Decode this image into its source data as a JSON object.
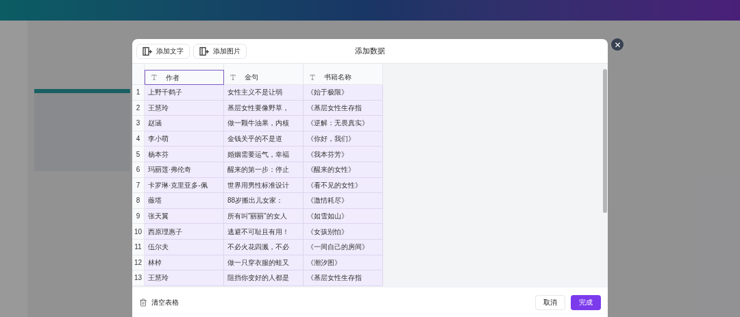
{
  "dialog": {
    "title": "添加数据",
    "toolbar": [
      {
        "label": "添加文字"
      },
      {
        "label": "添加图片"
      }
    ]
  },
  "table": {
    "columns": [
      {
        "label": "作者",
        "selected": true
      },
      {
        "label": "金句",
        "selected": false
      },
      {
        "label": "书籍名称",
        "selected": false
      }
    ],
    "rows": [
      {
        "number": "1",
        "cells": [
          "上野千鹤子",
          "女性主义不是让弱",
          "《始于极限》"
        ]
      },
      {
        "number": "2",
        "cells": [
          "王慧玲",
          "基层女性要像野草，",
          "《基层女性生存指"
        ]
      },
      {
        "number": "3",
        "cells": [
          "赵涵",
          "做一颗牛油果，内核",
          "《逆解：无畏真实》"
        ]
      },
      {
        "number": "4",
        "cells": [
          "李小萌",
          "金钱关乎的不是道",
          "《你好，我们》"
        ]
      },
      {
        "number": "5",
        "cells": [
          "杨本芬",
          "婚姻需要运气，幸福",
          "《我本芬芳》"
        ]
      },
      {
        "number": "6",
        "cells": [
          "玛丽莲·弗伦奇",
          "醒来的第一步：停止",
          "《醒来的女性》"
        ]
      },
      {
        "number": "7",
        "cells": [
          "卡罗琳·克里亚多-佩",
          "世界用男性标准设计",
          "《看不见的女性》"
        ]
      },
      {
        "number": "8",
        "cells": [
          "薇塔",
          "88岁搬出儿女家：",
          "《激情耗尽》"
        ]
      },
      {
        "number": "9",
        "cells": [
          "张天翼",
          "所有叫“丽丽”的女人",
          "《如雪如山》"
        ]
      },
      {
        "number": "10",
        "cells": [
          "西原理惠子",
          "逃避不可耻且有用！",
          "《女孩别怕》"
        ]
      },
      {
        "number": "11",
        "cells": [
          "伍尔夫",
          "不必火花四溅，不必",
          "《一间自己的房间》"
        ]
      },
      {
        "number": "12",
        "cells": [
          "林棹",
          "做一只穿衣服的蛙又",
          "《潮汐图》"
        ]
      },
      {
        "number": "13",
        "cells": [
          "王慧玲",
          "阻挡你变好的人都是",
          "《基层女性生存指"
        ]
      }
    ]
  },
  "footer": {
    "clear": "清空表格",
    "cancel": "取消",
    "done": "完成"
  }
}
